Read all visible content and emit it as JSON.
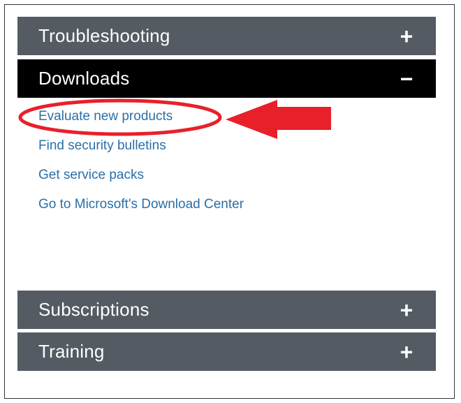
{
  "accordion": {
    "sections": [
      {
        "label": "Troubleshooting",
        "state_icon": "+"
      },
      {
        "label": "Downloads",
        "state_icon": "−"
      },
      {
        "label": "Subscriptions",
        "state_icon": "+"
      },
      {
        "label": "Training",
        "state_icon": "+"
      }
    ]
  },
  "downloads_links": [
    {
      "label": "Evaluate new products"
    },
    {
      "label": "Find security bulletins"
    },
    {
      "label": "Get service packs"
    },
    {
      "label": "Go to Microsoft's Download Center"
    }
  ],
  "colors": {
    "collapsed_bar": "#545b63",
    "expanded_bar": "#000000",
    "link": "#2a6fa8",
    "annotation_red": "#e8202a"
  },
  "icons": {
    "collapsed": "plus-icon",
    "expanded": "minus-icon",
    "annotation": "red-arrow-icon"
  }
}
